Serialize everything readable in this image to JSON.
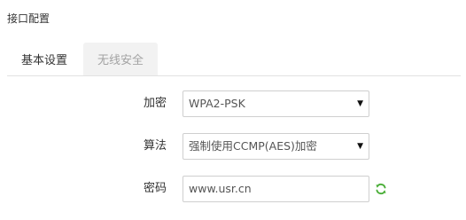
{
  "section": {
    "title": "接口配置"
  },
  "tabs": [
    {
      "label": "基本设置",
      "active": true
    },
    {
      "label": "无线安全",
      "active": false
    }
  ],
  "form": {
    "encryption": {
      "label": "加密",
      "value": "WPA2-PSK"
    },
    "algorithm": {
      "label": "算法",
      "value": "强制使用CCMP(AES)加密"
    },
    "password": {
      "label": "密码",
      "value": "www.usr.cn"
    }
  },
  "icons": {
    "dropdown": "triangle-down-icon",
    "refresh": "refresh-icon"
  },
  "colors": {
    "refresh_green": "#4caf3a",
    "inactive_tab_bg": "#f2f2f2"
  }
}
